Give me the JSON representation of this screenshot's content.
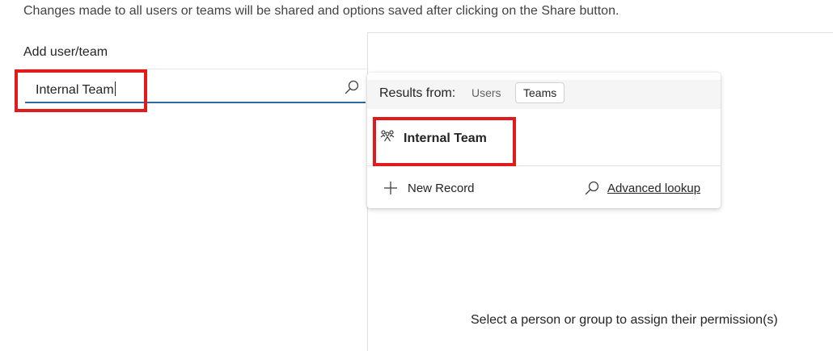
{
  "header": {
    "notice": "Changes made to all users or teams will be shared and options saved after clicking on the Share button."
  },
  "add_panel": {
    "label": "Add user/team",
    "search_value": "Internal Team",
    "search_icon": "search-icon"
  },
  "dropdown": {
    "results_from_label": "Results from:",
    "filters": [
      {
        "label": "Users",
        "selected": false
      },
      {
        "label": "Teams",
        "selected": true
      }
    ],
    "results": [
      {
        "icon": "team-icon",
        "name": "Internal Team"
      }
    ],
    "new_record_label": "New Record",
    "advanced_lookup_label": "Advanced lookup"
  },
  "permissions_panel": {
    "empty_message": "Select a person or group to assign their permission(s)"
  },
  "colors": {
    "accent_underline": "#2f6aa3",
    "highlight_box": "#e01b1b"
  }
}
